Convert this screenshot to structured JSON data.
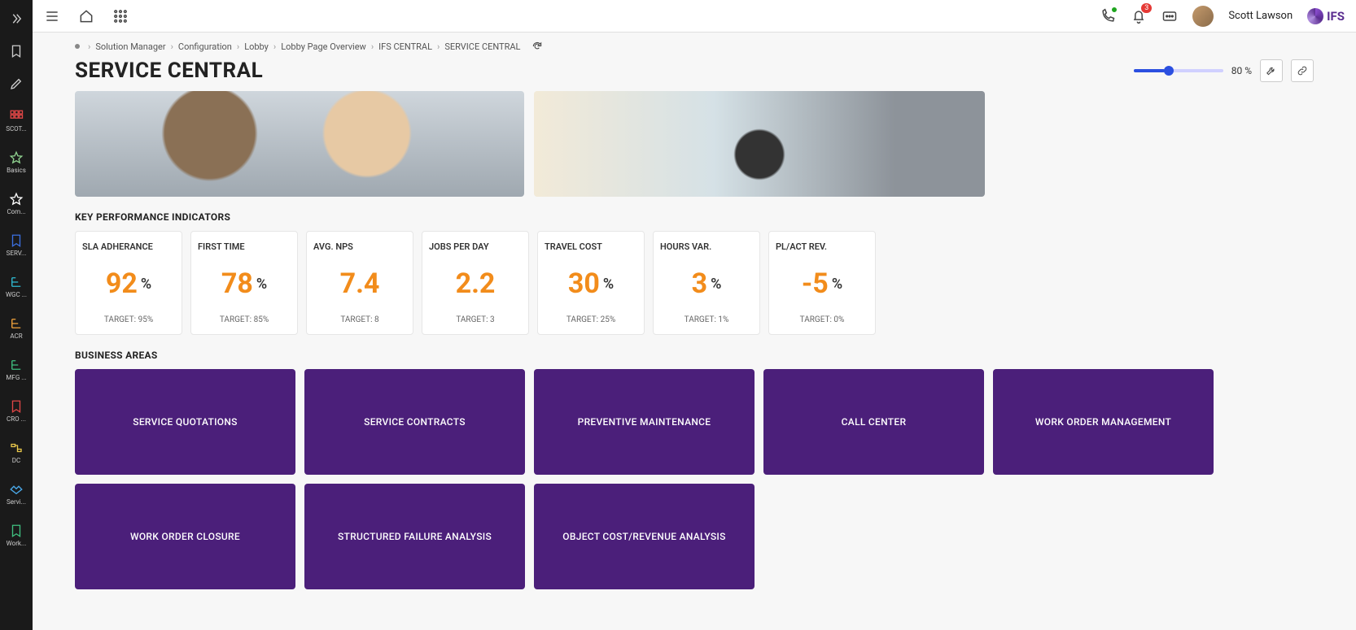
{
  "rail": {
    "items": [
      {
        "icon": "expand",
        "label": ""
      },
      {
        "icon": "bookmark-outline",
        "label": ""
      },
      {
        "icon": "pencil",
        "label": ""
      },
      {
        "icon": "grid-red",
        "label": "SCOT..."
      },
      {
        "icon": "star-outline",
        "label": "Basics"
      },
      {
        "icon": "star-filled",
        "label": "Com..."
      },
      {
        "icon": "bookmark-blue",
        "label": "SERV..."
      },
      {
        "icon": "tree-teal",
        "label": "WGC ..."
      },
      {
        "icon": "tree-orange",
        "label": "ACR"
      },
      {
        "icon": "tree-green",
        "label": "MFG ..."
      },
      {
        "icon": "bookmark-red",
        "label": "CRO ..."
      },
      {
        "icon": "flow-yellow",
        "label": "DC"
      },
      {
        "icon": "handshake-blue",
        "label": "Servi..."
      },
      {
        "icon": "bookmark-green",
        "label": "Work..."
      }
    ]
  },
  "topbar": {
    "user_name": "Scott Lawson",
    "logo_text": "IFS",
    "notification_count": "3"
  },
  "breadcrumb": {
    "items": [
      "Solution Manager",
      "Configuration",
      "Lobby",
      "Lobby Page Overview",
      "IFS CENTRAL",
      "SERVICE CENTRAL"
    ]
  },
  "page_title": "SERVICE CENTRAL",
  "zoom_percent": "80 %",
  "sections": {
    "kpi_heading": "KEY PERFORMANCE INDICATORS",
    "ba_heading": "BUSINESS AREAS"
  },
  "kpis": [
    {
      "title": "SLA ADHERANCE",
      "value": "92",
      "unit": "%",
      "target": "TARGET: 95%"
    },
    {
      "title": "FIRST TIME",
      "value": "78",
      "unit": "%",
      "target": "TARGET: 85%"
    },
    {
      "title": "AVG. NPS",
      "value": "7.4",
      "unit": "",
      "target": "TARGET: 8"
    },
    {
      "title": "JOBS PER DAY",
      "value": "2.2",
      "unit": "",
      "target": "TARGET: 3"
    },
    {
      "title": "TRAVEL COST",
      "value": "30",
      "unit": "%",
      "target": "TARGET: 25%"
    },
    {
      "title": "HOURS VAR.",
      "value": "3",
      "unit": "%",
      "target": "TARGET: 1%"
    },
    {
      "title": "PL/ACT REV.",
      "value": "-5",
      "unit": "%",
      "target": "TARGET: 0%"
    }
  ],
  "business_areas": [
    "SERVICE QUOTATIONS",
    "SERVICE CONTRACTS",
    "PREVENTIVE MAINTENANCE",
    "CALL CENTER",
    "WORK ORDER MANAGEMENT",
    "WORK ORDER CLOSURE",
    "STRUCTURED FAILURE ANALYSIS",
    "OBJECT COST/REVENUE ANALYSIS"
  ]
}
